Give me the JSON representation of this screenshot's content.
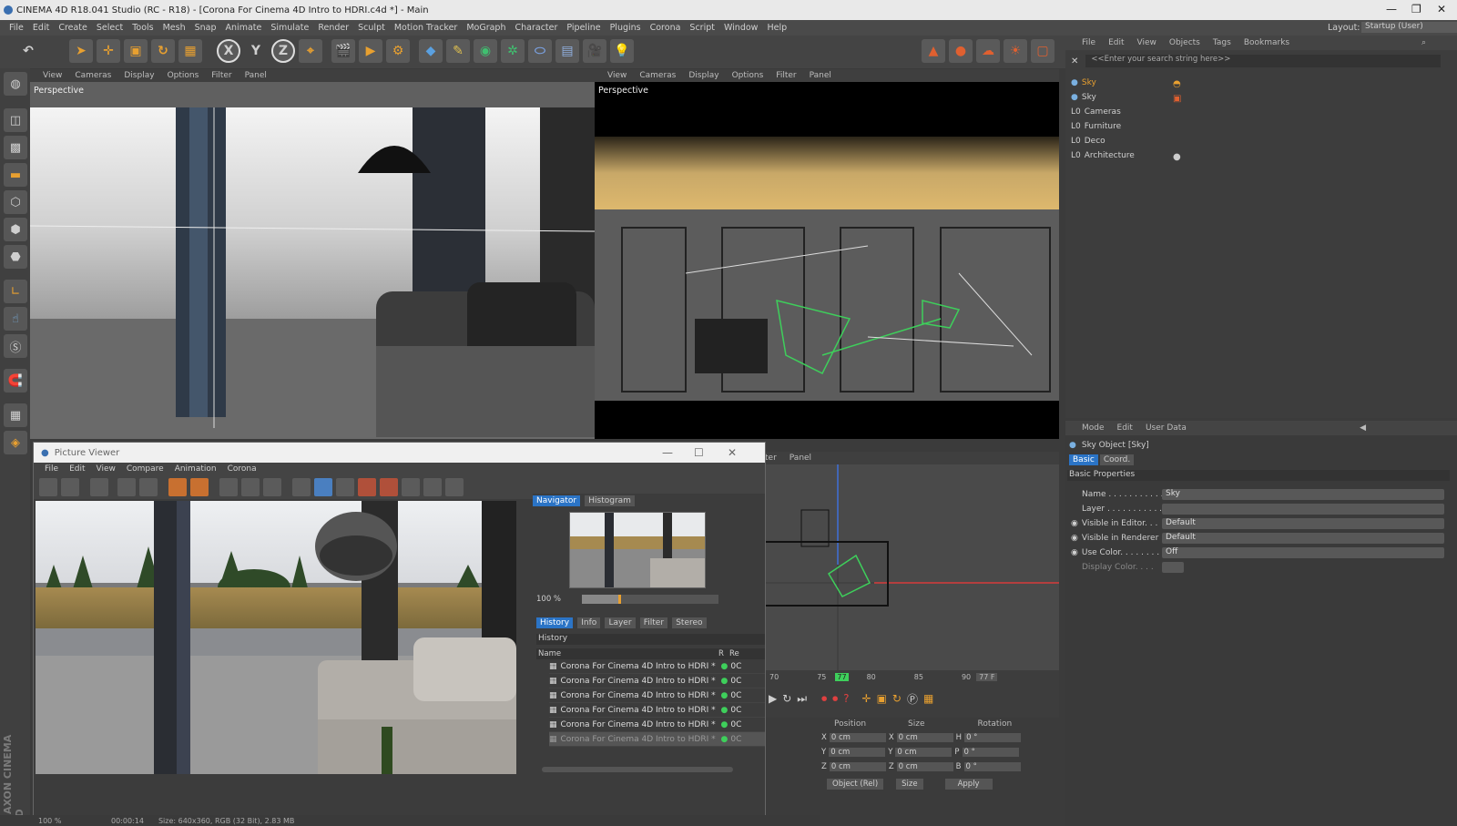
{
  "window": {
    "title": "CINEMA 4D R18.041 Studio (RC - R18) - [Corona For Cinema 4D Intro to HDRI.c4d *] - Main"
  },
  "menu": [
    "File",
    "Edit",
    "Create",
    "Select",
    "Tools",
    "Mesh",
    "Snap",
    "Animate",
    "Simulate",
    "Render",
    "Sculpt",
    "Motion Tracker",
    "MoGraph",
    "Character",
    "Pipeline",
    "Plugins",
    "Corona",
    "Script",
    "Window",
    "Help"
  ],
  "layout": {
    "label": "Layout:",
    "value": "Startup (User)"
  },
  "toolbar": {
    "x": "X",
    "y": "Y",
    "z": "Z"
  },
  "viewport_menu": [
    "View",
    "Cameras",
    "Display",
    "Options",
    "Filter",
    "Panel"
  ],
  "viewport_left": {
    "label": "Perspective"
  },
  "viewport_right": {
    "label": "Perspective"
  },
  "viewport_bottom": {
    "menu": [
      "ter",
      "Panel"
    ]
  },
  "objects": {
    "menu": [
      "File",
      "Edit",
      "View",
      "Objects",
      "Tags",
      "Bookmarks"
    ],
    "search_placeholder": "<<Enter your search string here>>",
    "items": [
      "Sky",
      "Sky",
      "Cameras",
      "Furniture",
      "Deco",
      "Architecture"
    ]
  },
  "attributes": {
    "menu": [
      "Mode",
      "Edit",
      "User Data"
    ],
    "object_title": "Sky Object [Sky]",
    "tabs": [
      "Basic",
      "Coord."
    ],
    "section": "Basic Properties",
    "rows": [
      {
        "label": "Name . . . . . . . . . . . .",
        "value": "Sky"
      },
      {
        "label": "Layer . . . . . . . . . . .",
        "value": ""
      },
      {
        "label": "Visible in Editor. . .",
        "value": "Default"
      },
      {
        "label": "Visible in Renderer",
        "value": "Default"
      },
      {
        "label": "Use Color. . . . . . . .",
        "value": "Off"
      },
      {
        "label": "Display Color. . . .",
        "value": ""
      }
    ]
  },
  "picture_viewer": {
    "title": "Picture Viewer",
    "menu": [
      "File",
      "Edit",
      "View",
      "Compare",
      "Animation",
      "Corona"
    ],
    "nav_tabs": [
      "Navigator",
      "Histogram"
    ],
    "zoom": "100 %",
    "info_tabs": [
      "History",
      "Info",
      "Layer",
      "Filter",
      "Stereo"
    ],
    "history_label": "History",
    "columns": [
      "Name",
      "R",
      "Re"
    ],
    "history": [
      "Corona For Cinema 4D Intro to HDRI *",
      "Corona For Cinema 4D Intro to HDRI *",
      "Corona For Cinema 4D Intro to HDRI *",
      "Corona For Cinema 4D Intro to HDRI *",
      "Corona For Cinema 4D Intro to HDRI *",
      "Corona For Cinema 4D Intro to HDRI *"
    ],
    "history_suffix": "0C"
  },
  "status": {
    "zoom": "100 %",
    "time": "00:00:14",
    "info": "Size: 640x360, RGB (32 Bit), 2.83 MB"
  },
  "timeline": {
    "ticks": [
      "70",
      "75",
      "77",
      "80",
      "85",
      "90"
    ],
    "frame": "77 F"
  },
  "coords": {
    "headers": [
      "Position",
      "Size",
      "Rotation"
    ],
    "rows": [
      {
        "a": "X",
        "pos": "0 cm",
        "b": "X",
        "size": "0 cm",
        "c": "H",
        "rot": "0 °"
      },
      {
        "a": "Y",
        "pos": "0 cm",
        "b": "Y",
        "size": "0 cm",
        "c": "P",
        "rot": "0 °"
      },
      {
        "a": "Z",
        "pos": "0 cm",
        "b": "Z",
        "size": "0 cm",
        "c": "B",
        "rot": "0 °"
      }
    ],
    "mode": "Object (Rel)",
    "size_mode": "Size",
    "apply": "Apply"
  },
  "brand": "MAXON CINEMA 4D",
  "colors": {
    "accent": "#2b74c6",
    "orange": "#e8a030",
    "green": "#3ecf5b",
    "dark": "#3b3b3b"
  }
}
